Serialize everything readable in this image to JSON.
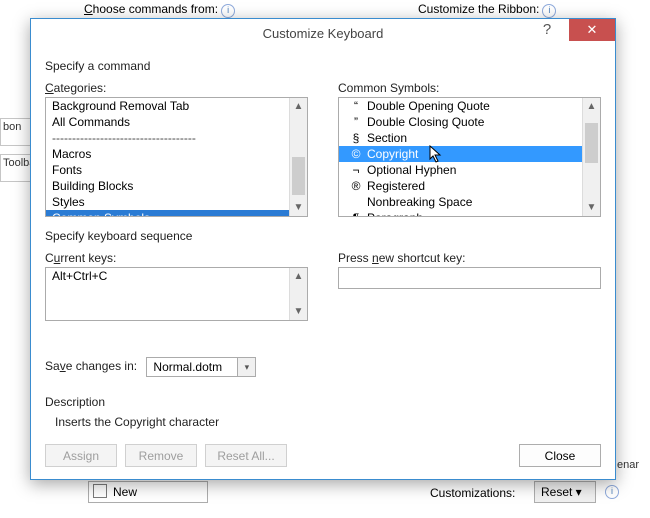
{
  "bg": {
    "choose_from": "Choose commands from:",
    "customize_ribbon": "Customize the Ribbon:",
    "ribbon_tab": "bon",
    "toolba_tab": "Toolba",
    "new": "New",
    "customizations": "Customizations:",
    "reset": "Reset ▾",
    "enar": "enar"
  },
  "dlg": {
    "title": "Customize Keyboard",
    "help": "?",
    "close_x": "✕",
    "specify_cmd": "Specify a command",
    "categories_lbl": "Categories:",
    "symbols_lbl": "Common Symbols:",
    "categories": [
      "Background Removal Tab",
      "All Commands",
      "------------------------------------",
      "Macros",
      "Fonts",
      "Building Blocks",
      "Styles",
      "Common Symbols"
    ],
    "symbols": [
      {
        "g": "“",
        "n": "Double Opening Quote"
      },
      {
        "g": "”",
        "n": "Double Closing Quote"
      },
      {
        "g": "§",
        "n": "Section"
      },
      {
        "g": "©",
        "n": "Copyright"
      },
      {
        "g": "¬",
        "n": "Optional Hyphen"
      },
      {
        "g": "®",
        "n": "Registered"
      },
      {
        "g": " ",
        "n": "Nonbreaking Space"
      },
      {
        "g": "¶",
        "n": "Paragraph"
      }
    ],
    "sym_sel": 3,
    "specify_seq": "Specify keyboard sequence",
    "current_keys_lbl": "Current keys:",
    "press_new_lbl": "Press new shortcut key:",
    "current_key": "Alt+Ctrl+C",
    "save_in_lbl": "Save changes in:",
    "save_in_value": "Normal.dotm",
    "description_lbl": "Description",
    "description_txt": "Inserts the Copyright character",
    "btn_assign": "Assign",
    "btn_remove": "Remove",
    "btn_resetall": "Reset All...",
    "btn_close": "Close"
  }
}
